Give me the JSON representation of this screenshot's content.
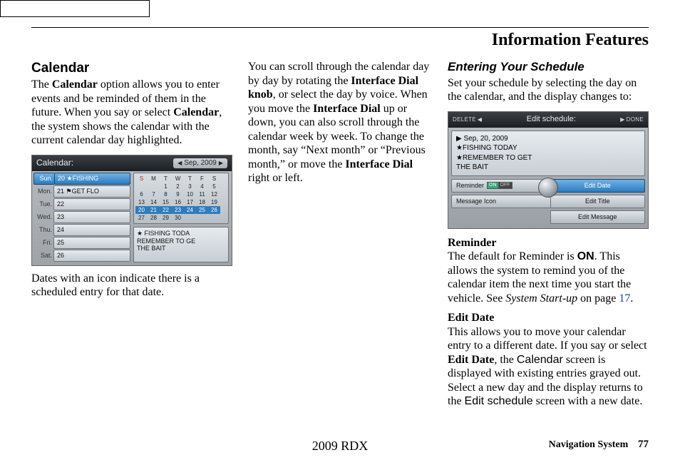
{
  "header": {
    "title": "Information Features"
  },
  "col1": {
    "heading": "Calendar",
    "p1a": "The ",
    "p1b": "Calendar",
    "p1c": " option allows you to enter events and be reminded of them in the future. When you say or select ",
    "p1d": "Calendar",
    "p1e": ", the system shows the calendar with the current calendar day highlighted.",
    "caption": "Dates with an icon indicate there is a scheduled entry for that date."
  },
  "calshot": {
    "title": "Calendar:",
    "month": "Sep, 2009",
    "days": [
      {
        "abbr": "Sun.",
        "num": "20",
        "txt": "★FISHING",
        "sel": true
      },
      {
        "abbr": "Mon.",
        "num": "21",
        "txt": "⚑GET FLO",
        "sel": false
      },
      {
        "abbr": "Tue.",
        "num": "22",
        "txt": "",
        "sel": false
      },
      {
        "abbr": "Wed.",
        "num": "23",
        "txt": "",
        "sel": false
      },
      {
        "abbr": "Thu.",
        "num": "24",
        "txt": "",
        "sel": false
      },
      {
        "abbr": "Fri.",
        "num": "25",
        "txt": "",
        "sel": false
      },
      {
        "abbr": "Sat.",
        "num": "26",
        "txt": "",
        "sel": false
      }
    ],
    "dow": [
      "S",
      "M",
      "T",
      "W",
      "T",
      "F",
      "S"
    ],
    "grid": [
      [
        "",
        "",
        "1",
        "2",
        "3",
        "4",
        "5"
      ],
      [
        "6",
        "7",
        "8",
        "9",
        "10",
        "11",
        "12"
      ],
      [
        "13",
        "14",
        "15",
        "16",
        "17",
        "18",
        "19"
      ],
      [
        "20",
        "21",
        "22",
        "23",
        "24",
        "25",
        "26"
      ],
      [
        "27",
        "28",
        "29",
        "30",
        "",
        "",
        ""
      ]
    ],
    "hl_row": 3,
    "note_l1": "★ FISHING TODA",
    "note_l2": "REMEMBER TO GE",
    "note_l3": "THE BAIT"
  },
  "col2": {
    "p1a": "You can scroll through the calendar day by day by rotating the ",
    "p1b": "Interface Dial knob",
    "p1c": ", or select the day by voice. When you move the ",
    "p1d": "Interface Dial",
    "p1e": " up or down, you can also scroll through the calendar week by week. To change the month, say “Next month” or “Previous month,” or move the ",
    "p1f": "Interface Dial",
    "p1g": " right or left."
  },
  "col3": {
    "heading": "Entering Your Schedule",
    "intro": "Set your schedule by selecting the day on the calendar, and the display changes to:",
    "rem_h": "Reminder",
    "rem_a": "The default for Reminder is ",
    "rem_b": "ON",
    "rem_c": ". This allows the system to remind you of the calendar item the next time you start the vehicle. See ",
    "rem_d": "System Start-up",
    "rem_e": " on page ",
    "rem_pg": "17",
    "rem_f": ".",
    "ed_h": "Edit Date",
    "ed_a": "This allows you to move your calendar entry to a different date. If you say or select ",
    "ed_b": "Edit Date",
    "ed_c": ", the ",
    "ed_d": "Calendar",
    "ed_e": " screen is displayed with existing entries grayed out. Select a new day and the display returns to the ",
    "ed_f": "Edit schedule",
    "ed_g": " screen with a new date."
  },
  "editshot": {
    "delete": "DELETE",
    "title": "Edit schedule:",
    "done": "DONE",
    "l1": "▶ Sep, 20, 2009",
    "l2": "★FISHING TODAY",
    "l3": "★REMEMBER TO GET",
    "l4": "  THE BAIT",
    "btn_rem": "Reminder",
    "btn_date": "Edit Date",
    "btn_icon": "Message Icon",
    "btn_title": "Edit Title",
    "btn_msg": "Edit Message",
    "on": "ON",
    "off": "OFF"
  },
  "footer": {
    "model": "2009  RDX",
    "label": "Navigation System",
    "page": "77"
  }
}
